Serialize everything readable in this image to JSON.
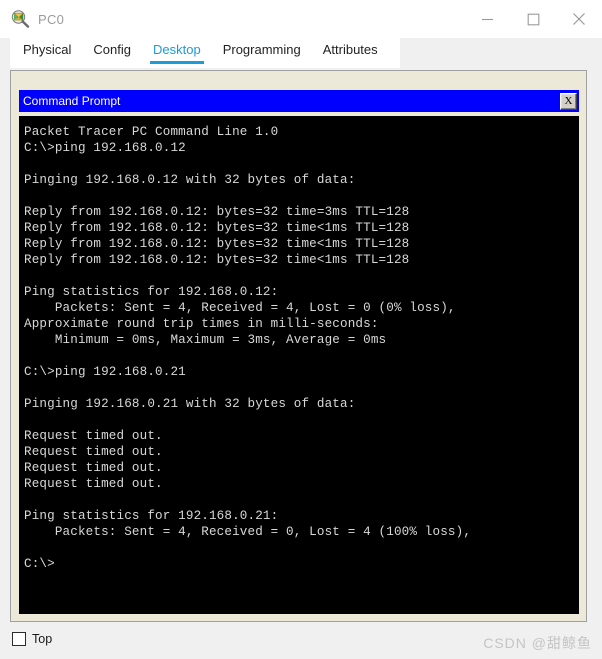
{
  "window": {
    "title": "PC0",
    "icon": "packet-tracer-magnifier-icon",
    "controls": {
      "minimize": "—",
      "maximize": "□",
      "close": "✕"
    }
  },
  "tabs": [
    {
      "label": "Physical",
      "active": false
    },
    {
      "label": "Config",
      "active": false
    },
    {
      "label": "Desktop",
      "active": true
    },
    {
      "label": "Programming",
      "active": false
    },
    {
      "label": "Attributes",
      "active": false
    }
  ],
  "command_prompt": {
    "title": "Command Prompt",
    "close_label": "X",
    "terminal_text": "Packet Tracer PC Command Line 1.0\nC:\\>ping 192.168.0.12\n\nPinging 192.168.0.12 with 32 bytes of data:\n\nReply from 192.168.0.12: bytes=32 time=3ms TTL=128\nReply from 192.168.0.12: bytes=32 time<1ms TTL=128\nReply from 192.168.0.12: bytes=32 time<1ms TTL=128\nReply from 192.168.0.12: bytes=32 time<1ms TTL=128\n\nPing statistics for 192.168.0.12:\n    Packets: Sent = 4, Received = 4, Lost = 0 (0% loss),\nApproximate round trip times in milli-seconds:\n    Minimum = 0ms, Maximum = 3ms, Average = 0ms\n\nC:\\>ping 192.168.0.21\n\nPinging 192.168.0.21 with 32 bytes of data:\n\nRequest timed out.\nRequest timed out.\nRequest timed out.\nRequest timed out.\n\nPing statistics for 192.168.0.21:\n    Packets: Sent = 4, Received = 0, Lost = 4 (100% loss),\n\nC:\\>"
  },
  "footer": {
    "top_checkbox_label": "Top",
    "top_checkbox_checked": false,
    "watermark": "CSDN @甜鲸鱼"
  },
  "colors": {
    "accent_tab": "#1b9bd8",
    "cmd_titlebar": "#0000ff",
    "panel_bg": "#ece9d8",
    "terminal_bg": "#000000",
    "terminal_fg": "#d8d8d8"
  }
}
